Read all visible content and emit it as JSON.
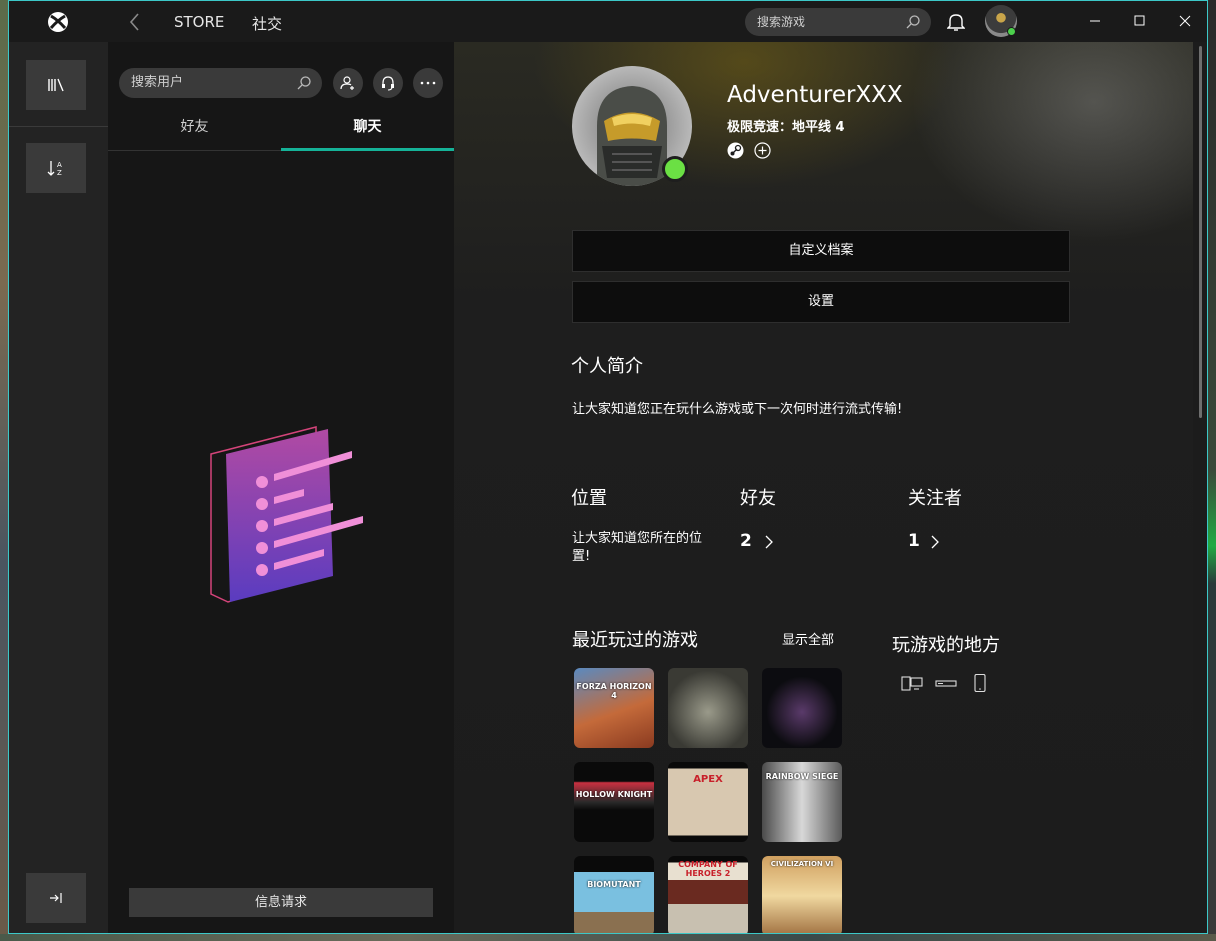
{
  "titlebar": {
    "store_label": "STORE",
    "social_label": "社交",
    "search_placeholder": "搜索游戏"
  },
  "friends_panel": {
    "search_placeholder": "搜索用户",
    "tabs": [
      {
        "label": "好友",
        "active": false
      },
      {
        "label": "聊天",
        "active": true
      }
    ],
    "message_requests_label": "信息请求"
  },
  "profile": {
    "gamertag": "AdventurerXXX",
    "now_playing": "极限竞速：地平线 4",
    "online": true,
    "customize_label": "自定义档案",
    "settings_label": "设置",
    "bio_title": "个人简介",
    "bio_text": "让大家知道您正在玩什么游戏或下一次何时进行流式传输!",
    "location_title": "位置",
    "location_text": "让大家知道您所在的位置!",
    "friends_title": "好友",
    "friends_count": "2",
    "followers_title": "关注者",
    "followers_count": "1",
    "recent_title": "最近玩过的游戏",
    "show_all_label": "显示全部",
    "where_title": "玩游戏的地方"
  },
  "recent_games": [
    {
      "art": "FORZA HORIZON 4"
    },
    {
      "art": ""
    },
    {
      "art": ""
    },
    {
      "art": "HOLLOW KNIGHT"
    },
    {
      "art": "APEX"
    },
    {
      "art": "RAINBOW SIEGE"
    },
    {
      "art": "BIOMUTANT"
    },
    {
      "art": "COMPANY OF HEROES 2"
    },
    {
      "art": "CIVILIZATION VI"
    }
  ],
  "colors": {
    "accent": "#15b298",
    "online": "#6be044",
    "window_border": "#3cc8c8"
  }
}
